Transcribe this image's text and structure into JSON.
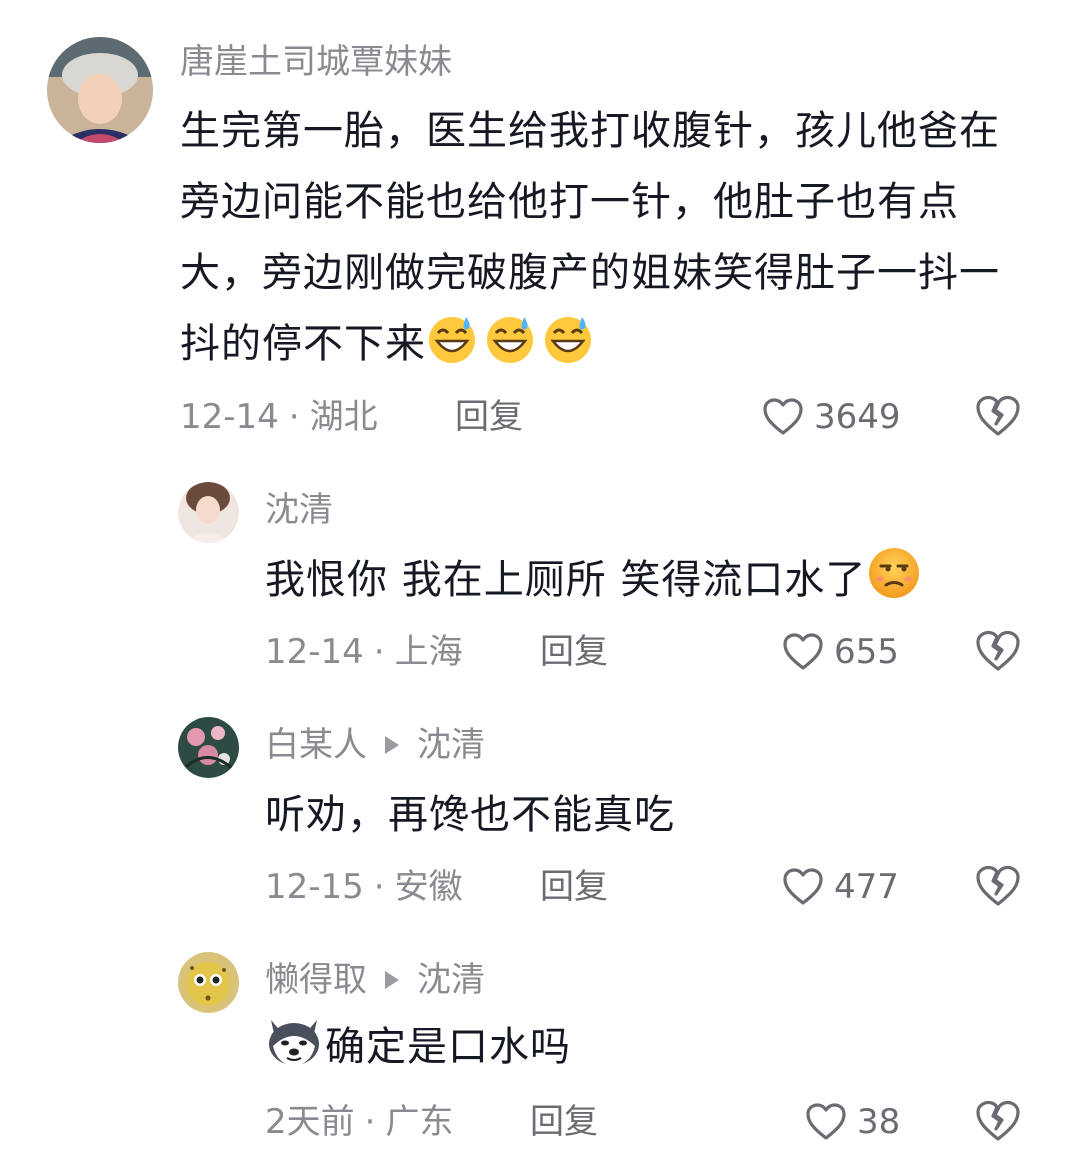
{
  "comments": [
    {
      "author": "唐崖土司城覃妹妹",
      "text": "生完第一胎，医生给我打收腹针，孩儿他爸在旁边问能不能也给他打一针，他肚子也有点大，旁边刚做完破腹产的姐妹笑得肚子一抖一抖的停不下来",
      "emojis": [
        "grinning-sweat-emoji",
        "grinning-sweat-emoji",
        "grinning-sweat-emoji"
      ],
      "date": "12-14",
      "location": "湖北",
      "reply_label": "回复",
      "likes": "3649"
    },
    {
      "author": "沈清",
      "text": "我恨你 我在上厕所 笑得流口水了",
      "emojis": [
        "unamused-emoji"
      ],
      "date": "12-14",
      "location": "上海",
      "reply_label": "回复",
      "likes": "655"
    },
    {
      "author": "白某人",
      "reply_to": "沈清",
      "text": "听劝，再馋也不能真吃",
      "date": "12-15",
      "location": "安徽",
      "reply_label": "回复",
      "likes": "477"
    },
    {
      "author": "懒得取",
      "reply_to": "沈清",
      "leading_emoji": "husky-emoji",
      "text": "确定是口水吗",
      "date": "2天前",
      "location": "广东",
      "reply_label": "回复",
      "likes": "38"
    }
  ],
  "colors": {
    "text": "#161823",
    "secondary": "#8a8b91",
    "emoji_yellow": "#ffc83d"
  }
}
